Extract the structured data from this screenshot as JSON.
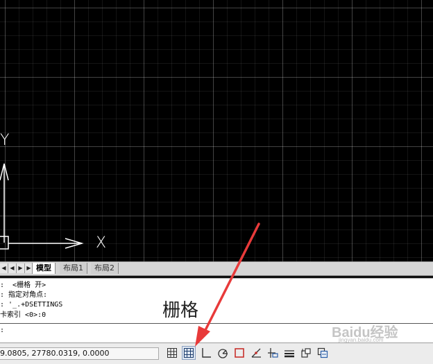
{
  "canvas": {
    "axis_x": "X",
    "axis_y": "Y"
  },
  "tabs": {
    "model": "模型",
    "layout1": "布局1",
    "layout2": "布局2"
  },
  "command_history": [
    ":  <栅格 开>",
    ": 指定对角点:",
    ": '_.+DSETTINGS",
    "卡索引 <0>:0"
  ],
  "command_prompt": ":",
  "caption": "栅格",
  "status": {
    "coordinates": "9.0805, 27780.0319, 0.0000",
    "buttons": [
      {
        "name": "snap-mode-button",
        "icon": "snap-grid-icon"
      },
      {
        "name": "grid-display-button",
        "icon": "grid-icon",
        "active": true
      },
      {
        "name": "ortho-mode-button",
        "icon": "ortho-icon"
      },
      {
        "name": "polar-tracking-button",
        "icon": "polar-icon"
      },
      {
        "name": "object-snap-button",
        "icon": "osnap-icon"
      },
      {
        "name": "object-snap-tracking-button",
        "icon": "otrack-icon"
      },
      {
        "name": "dynamic-ucs-button",
        "icon": "ducs-icon"
      },
      {
        "name": "dynamic-input-button",
        "icon": "dyn-icon"
      },
      {
        "name": "lineweight-button",
        "icon": "lineweight-icon"
      },
      {
        "name": "quick-properties-button",
        "icon": "qp-icon"
      }
    ]
  },
  "watermark": {
    "logo": "Baidu经验",
    "url": "jingyan.baidu.com"
  },
  "colors": {
    "arrow": "#e83a3a",
    "canvas_bg": "#000000"
  }
}
